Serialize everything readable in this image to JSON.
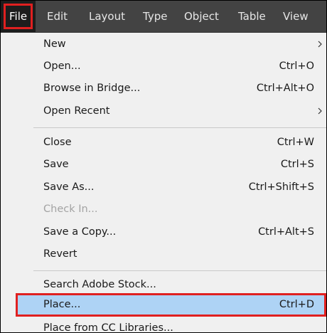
{
  "menubar": {
    "items": [
      {
        "label": "File"
      },
      {
        "label": "Edit"
      },
      {
        "label": "Layout"
      },
      {
        "label": "Type"
      },
      {
        "label": "Object"
      },
      {
        "label": "Table"
      },
      {
        "label": "View"
      }
    ]
  },
  "file_menu": {
    "items": [
      {
        "label": "New",
        "shortcut": "",
        "submenu": true
      },
      {
        "label": "Open...",
        "shortcut": "Ctrl+O"
      },
      {
        "label": "Browse in Bridge...",
        "shortcut": "Ctrl+Alt+O"
      },
      {
        "label": "Open Recent",
        "shortcut": "",
        "submenu": true
      },
      {
        "label": "Close",
        "shortcut": "Ctrl+W"
      },
      {
        "label": "Save",
        "shortcut": "Ctrl+S"
      },
      {
        "label": "Save As...",
        "shortcut": "Ctrl+Shift+S"
      },
      {
        "label": "Check In...",
        "shortcut": "",
        "disabled": true
      },
      {
        "label": "Save a Copy...",
        "shortcut": "Ctrl+Alt+S"
      },
      {
        "label": "Revert",
        "shortcut": ""
      },
      {
        "label": "Search Adobe Stock...",
        "shortcut": ""
      },
      {
        "label": "Place...",
        "shortcut": "Ctrl+D",
        "highlighted": true
      },
      {
        "label": "Place from CC Libraries...",
        "shortcut": ""
      }
    ]
  },
  "colors": {
    "menubar_bg": "#434343",
    "menu_bg": "#f0f0f0",
    "highlight_bg": "#aed3f5",
    "annotation_red": "#e02020"
  }
}
